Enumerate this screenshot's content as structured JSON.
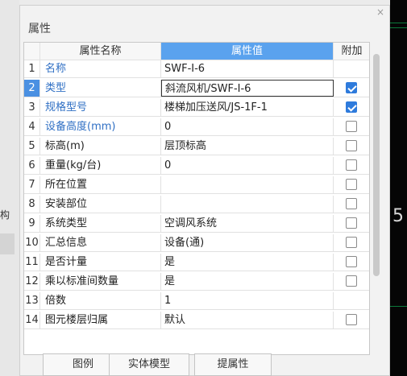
{
  "left_edge_glyph": "构",
  "cad_number": "5",
  "panel": {
    "title": "属性",
    "close_glyph": "×"
  },
  "grid": {
    "headers": {
      "name": "属性名称",
      "value": "属性值",
      "add": "附加"
    },
    "rows": [
      {
        "num": "1",
        "name": "名称",
        "value": "SWF-I-6",
        "checked": null,
        "blue": true
      },
      {
        "num": "2",
        "name": "类型",
        "value": "斜流风机/SWF-I-6",
        "checked": true,
        "blue": true,
        "selected": true
      },
      {
        "num": "3",
        "name": "规格型号",
        "value": "楼梯加压送风/JS-1F-1",
        "checked": true,
        "blue": true
      },
      {
        "num": "4",
        "name": "设备高度(mm)",
        "value": "0",
        "checked": false,
        "blue": true
      },
      {
        "num": "5",
        "name": "标高(m)",
        "value": "层顶标高",
        "checked": false,
        "blue": false
      },
      {
        "num": "6",
        "name": "重量(kg/台)",
        "value": "0",
        "checked": false,
        "blue": false
      },
      {
        "num": "7",
        "name": "所在位置",
        "value": "",
        "checked": false,
        "blue": false
      },
      {
        "num": "8",
        "name": "安装部位",
        "value": "",
        "checked": false,
        "blue": false
      },
      {
        "num": "9",
        "name": "系统类型",
        "value": "空调风系统",
        "checked": false,
        "blue": false
      },
      {
        "num": "10",
        "name": "汇总信息",
        "value": "设备(通)",
        "checked": false,
        "blue": false
      },
      {
        "num": "11",
        "name": "是否计量",
        "value": "是",
        "checked": false,
        "blue": false
      },
      {
        "num": "12",
        "name": "乘以标准间数量",
        "value": "是",
        "checked": false,
        "blue": false
      },
      {
        "num": "13",
        "name": "倍数",
        "value": "1",
        "checked": null,
        "blue": false
      },
      {
        "num": "14",
        "name": "图元楼层归属",
        "value": "默认",
        "checked": false,
        "blue": false
      }
    ]
  },
  "buttons": {
    "legend": "图例",
    "solid_model": "实体模型",
    "extract": "提属性"
  },
  "colors": {
    "accent": "#2e7bdc",
    "header_value_bg": "#5aa2ee",
    "link_text": "#2f6fc4"
  }
}
